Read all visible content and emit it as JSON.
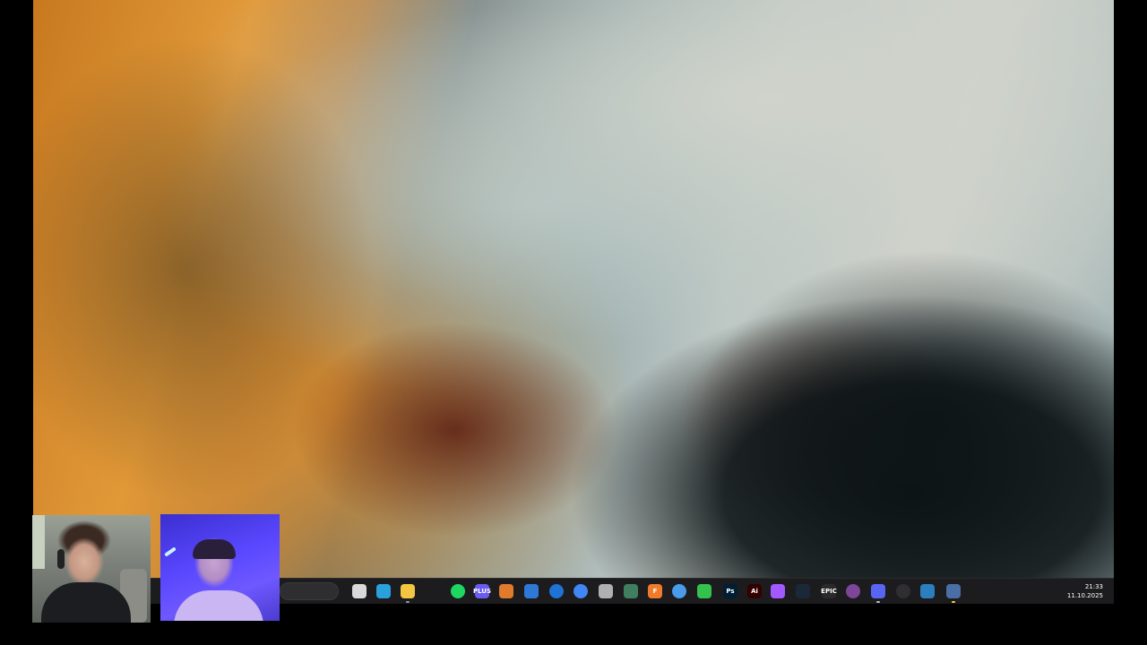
{
  "desktop": {
    "wallpaper": "aerial-river-delta",
    "colors": {
      "orange": "#e19a3a",
      "silt": "#cfd2cb",
      "dark": "#0d1416"
    }
  },
  "taskbar": {
    "background": "#1c1c1e",
    "icons": [
      {
        "name": "task-view-icon",
        "label": "",
        "color": "#d9d9d9"
      },
      {
        "name": "telegram-icon",
        "label": "",
        "color": "#2aa1dc"
      },
      {
        "name": "file-explorer-icon",
        "label": "",
        "color": "#f4c542"
      },
      {
        "name": "spotify-icon",
        "label": "",
        "color": "#1ed760"
      },
      {
        "name": "plus-app-icon",
        "label": "PLUS",
        "color": "#6a5cf0"
      },
      {
        "name": "browser-shield-icon",
        "label": "",
        "color": "#e07a2c"
      },
      {
        "name": "outlook-icon",
        "label": "",
        "color": "#2f79d6"
      },
      {
        "name": "teamviewer-icon",
        "label": "",
        "color": "#1f72d6"
      },
      {
        "name": "chrome-icon",
        "label": "",
        "color": "#4285f4"
      },
      {
        "name": "pen-tool-icon",
        "label": "",
        "color": "#b0b0b0"
      },
      {
        "name": "game-launcher-icon",
        "label": "",
        "color": "#3f7f5f"
      },
      {
        "name": "f-app-icon",
        "label": "F",
        "color": "#f07b2a"
      },
      {
        "name": "settings-ring-icon",
        "label": "",
        "color": "#4a9bea"
      },
      {
        "name": "phone-app-icon",
        "label": "",
        "color": "#33c24d"
      },
      {
        "name": "photoshop-icon",
        "label": "Ps",
        "color": "#001e36"
      },
      {
        "name": "illustrator-icon",
        "label": "Ai",
        "color": "#330000"
      },
      {
        "name": "figma-icon",
        "label": "",
        "color": "#a259ff"
      },
      {
        "name": "steam-icon",
        "label": "",
        "color": "#1b2838"
      },
      {
        "name": "epic-games-icon",
        "label": "EPIC",
        "color": "#2a2a2a"
      },
      {
        "name": "tor-browser-icon",
        "label": "",
        "color": "#7d4698"
      },
      {
        "name": "discord-icon",
        "label": "",
        "color": "#5865f2"
      },
      {
        "name": "obs-icon",
        "label": "",
        "color": "#302e31"
      },
      {
        "name": "steam-icon-2",
        "label": "",
        "color": "#2c7fbf"
      },
      {
        "name": "cheat-engine-icon",
        "label": "",
        "color": "#4a6fa5"
      }
    ],
    "clock": {
      "time": "21:33",
      "date": "11.10.2025"
    }
  },
  "cameras": [
    {
      "name": "webcam-1",
      "background": "#7b817a"
    },
    {
      "name": "webcam-2",
      "background": "#5a48ff"
    }
  ]
}
